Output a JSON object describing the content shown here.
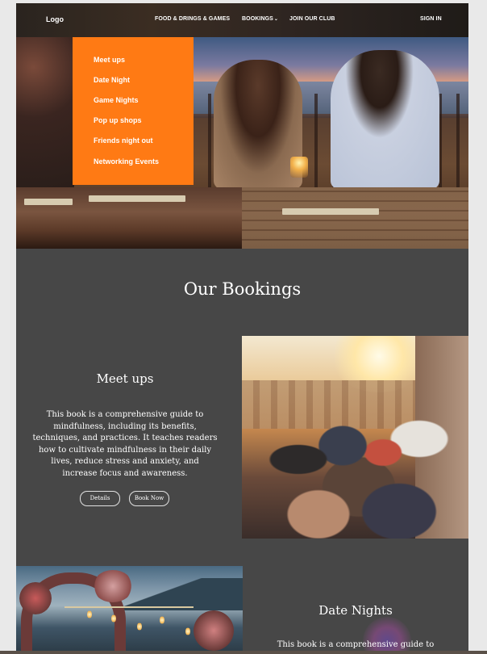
{
  "nav": {
    "logo": "Logo",
    "links": [
      "FOOD & DRINGS & GAMES",
      "BOOKINGS",
      "JOIN OUR CLUB"
    ],
    "sign_in": "SIGN IN"
  },
  "dropdown": {
    "items": [
      "Meet ups",
      "Date Night",
      "Game Nights",
      "Pop up shops",
      "Friends night out",
      "Networking Events"
    ],
    "background": "#ff7a14"
  },
  "bookings": {
    "title": "Our Bookings",
    "cards": [
      {
        "title": "Meet ups",
        "text": [
          "This book is a comprehensive guide to",
          "mindfulness, including its benefits,",
          "techniques, and practices. It teaches readers",
          "how to cultivate mindfulness in their daily",
          "lives, reduce stress and anxiety, and",
          "increase focus and awareness."
        ],
        "details_label": "Details",
        "book_label": "Book Now"
      },
      {
        "title": "Date Nights",
        "text": [
          "This book is a comprehensive guide to"
        ]
      }
    ]
  },
  "colors": {
    "page_background": "#474747",
    "accent": "#ff7a14",
    "text": "#ffffff"
  }
}
